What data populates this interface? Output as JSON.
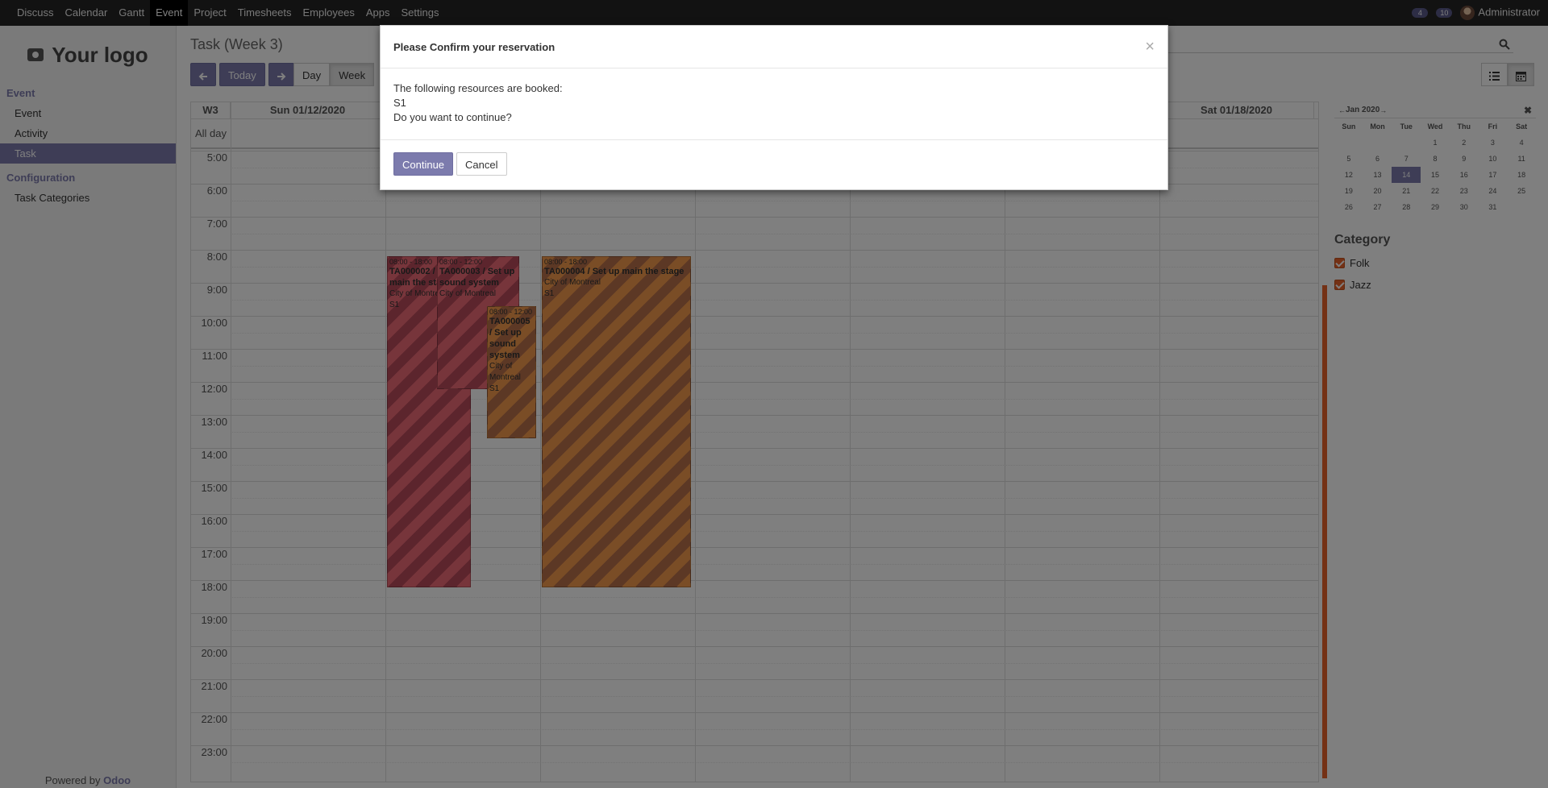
{
  "topbar": {
    "menu": [
      "Discuss",
      "Calendar",
      "Gantt",
      "Event",
      "Project",
      "Timesheets",
      "Employees",
      "Apps",
      "Settings"
    ],
    "active_index": 3,
    "chat_count": "4",
    "activity_count": "10",
    "user": "Administrator"
  },
  "sidebar": {
    "logo_text": "Your logo",
    "section1": "Event",
    "items1": [
      "Event",
      "Activity",
      "Task"
    ],
    "section2": "Configuration",
    "items2": [
      "Task Categories"
    ],
    "powered_prefix": "Powered by",
    "powered_brand": "Odoo"
  },
  "main": {
    "title": "Task (Week 3)",
    "today_label": "Today",
    "day_label": "Day",
    "week_label": "Week"
  },
  "calendar": {
    "week_label": "W3",
    "col_sun": "Sun 01/12/2020",
    "col_sat": "Sat 01/18/2020",
    "allday_label": "All day",
    "hours": [
      "5:00",
      "6:00",
      "7:00",
      "8:00",
      "9:00",
      "10:00",
      "11:00",
      "12:00",
      "13:00",
      "14:00",
      "15:00",
      "16:00",
      "17:00",
      "18:00",
      "19:00",
      "20:00",
      "21:00",
      "22:00",
      "23:00"
    ],
    "events": [
      {
        "time": "08:00 - 18:00",
        "title": "TA000002 / Set up main the stage",
        "place": "City of Montreal",
        "res": "S1"
      },
      {
        "time": "08:00 - 12:00",
        "title": "TA000003 / Set up sound system",
        "place": "City of Montreal",
        "res": "S1"
      },
      {
        "time": "08:00 - 12:00",
        "title": "TA000005 / Set up sound system",
        "place": "City of Montreal",
        "res": "S1"
      },
      {
        "time": "08:00 - 18:00",
        "title": "TA000004 / Set up main the stage",
        "place": "City of Montreal",
        "res": "S1"
      }
    ]
  },
  "mini_calendar": {
    "title": "Jan 2020",
    "dows": [
      "Sun",
      "Mon",
      "Tue",
      "Wed",
      "Thu",
      "Fri",
      "Sat"
    ],
    "weeks": [
      [
        "",
        "",
        "",
        "1",
        "2",
        "3",
        "4"
      ],
      [
        "5",
        "6",
        "7",
        "8",
        "9",
        "10",
        "11"
      ],
      [
        "12",
        "13",
        "14",
        "15",
        "16",
        "17",
        "18"
      ],
      [
        "19",
        "20",
        "21",
        "22",
        "23",
        "24",
        "25"
      ],
      [
        "26",
        "27",
        "28",
        "29",
        "30",
        "31",
        ""
      ]
    ],
    "today": "14"
  },
  "filters": {
    "title": "Category",
    "items": [
      "Folk",
      "Jazz"
    ]
  },
  "modal": {
    "title": "Please Confirm your reservation",
    "close": "×",
    "line1": "The following resources are booked:",
    "line2": "S1",
    "line3": "Do you want to continue?",
    "continue_label": "Continue",
    "cancel_label": "Cancel"
  },
  "colors": {
    "accent": "#7c7bad",
    "event_red": "#ee6a76",
    "event_orange": "#f59a4c",
    "checkbox": "#e8622a"
  }
}
